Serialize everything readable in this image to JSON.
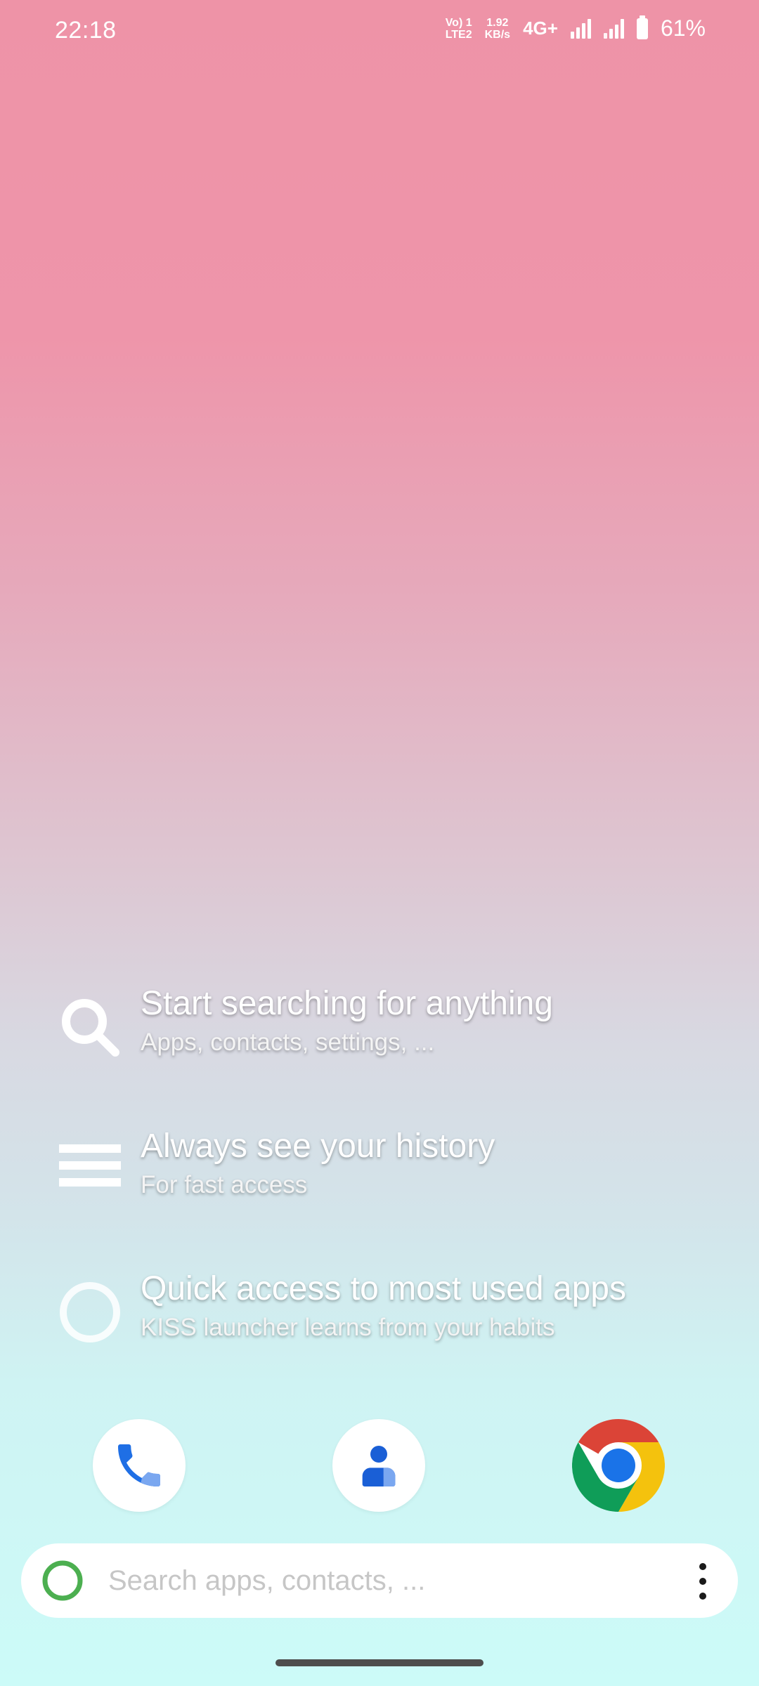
{
  "status_bar": {
    "time": "22:18",
    "volte_top": "Vo) 1",
    "volte_bottom": "LTE2",
    "speed_value": "1.92",
    "speed_unit": "KB/s",
    "network_type": "4G+",
    "battery_percent": "61%",
    "battery_level": 0.61
  },
  "hints": [
    {
      "title": "Start searching for anything",
      "subtitle": "Apps, contacts, settings, ...",
      "icon": "search-icon"
    },
    {
      "title": "Always see your history",
      "subtitle": "For fast access",
      "icon": "list-icon"
    },
    {
      "title": "Quick access to most used apps",
      "subtitle": "KISS launcher learns from your habits",
      "icon": "circle-icon"
    }
  ],
  "favorites": [
    {
      "name": "Phone",
      "icon": "phone-icon"
    },
    {
      "name": "Contacts",
      "icon": "contacts-icon"
    },
    {
      "name": "Chrome",
      "icon": "chrome-icon"
    }
  ],
  "search": {
    "placeholder": "Search apps, contacts, ...",
    "value": ""
  },
  "colors": {
    "gradient_top": "#ee93a7",
    "gradient_bottom": "#ccfbf8",
    "launcher_ring": "#4caf50",
    "phone_blue": "#1f6fe5",
    "contacts_blue": "#1a5fd6"
  }
}
